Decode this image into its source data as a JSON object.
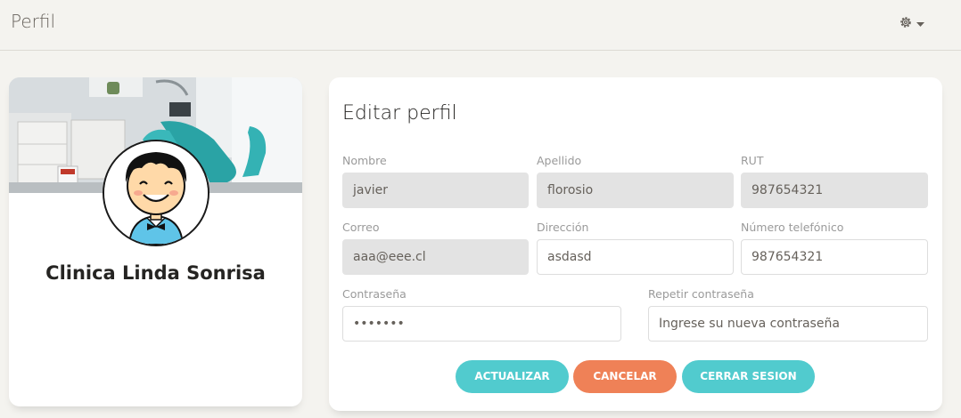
{
  "header": {
    "title": "Perfil",
    "settings_icon": "gear-icon",
    "dropdown_icon": "caret-down-icon"
  },
  "profile": {
    "banner_image": "dental-office-photo",
    "avatar_image": "cartoon-boy-avatar",
    "clinic_name": "Clinica Linda Sonrisa"
  },
  "form": {
    "title": "Editar perfil",
    "nombre": {
      "label": "Nombre",
      "value": "javier"
    },
    "apellido": {
      "label": "Apellido",
      "value": "florosio"
    },
    "rut": {
      "label": "RUT",
      "value": "987654321"
    },
    "correo": {
      "label": "Correo",
      "value": "aaa@eee.cl"
    },
    "direccion": {
      "label": "Dirección",
      "value": "asdasd"
    },
    "telefono": {
      "label": "Número telefónico",
      "value": "987654321"
    },
    "password": {
      "label": "Contraseña",
      "value": "•••••••"
    },
    "repeat_password": {
      "label": "Repetir contraseña",
      "placeholder": "Ingrese su nueva contraseña"
    }
  },
  "buttons": {
    "update": "ACTUALIZAR",
    "cancel": "CANCELAR",
    "logout": "CERRAR SESION"
  },
  "colors": {
    "accent_teal": "#51cbce",
    "accent_orange": "#ef8157",
    "readonly_bg": "#e3e3e3"
  }
}
